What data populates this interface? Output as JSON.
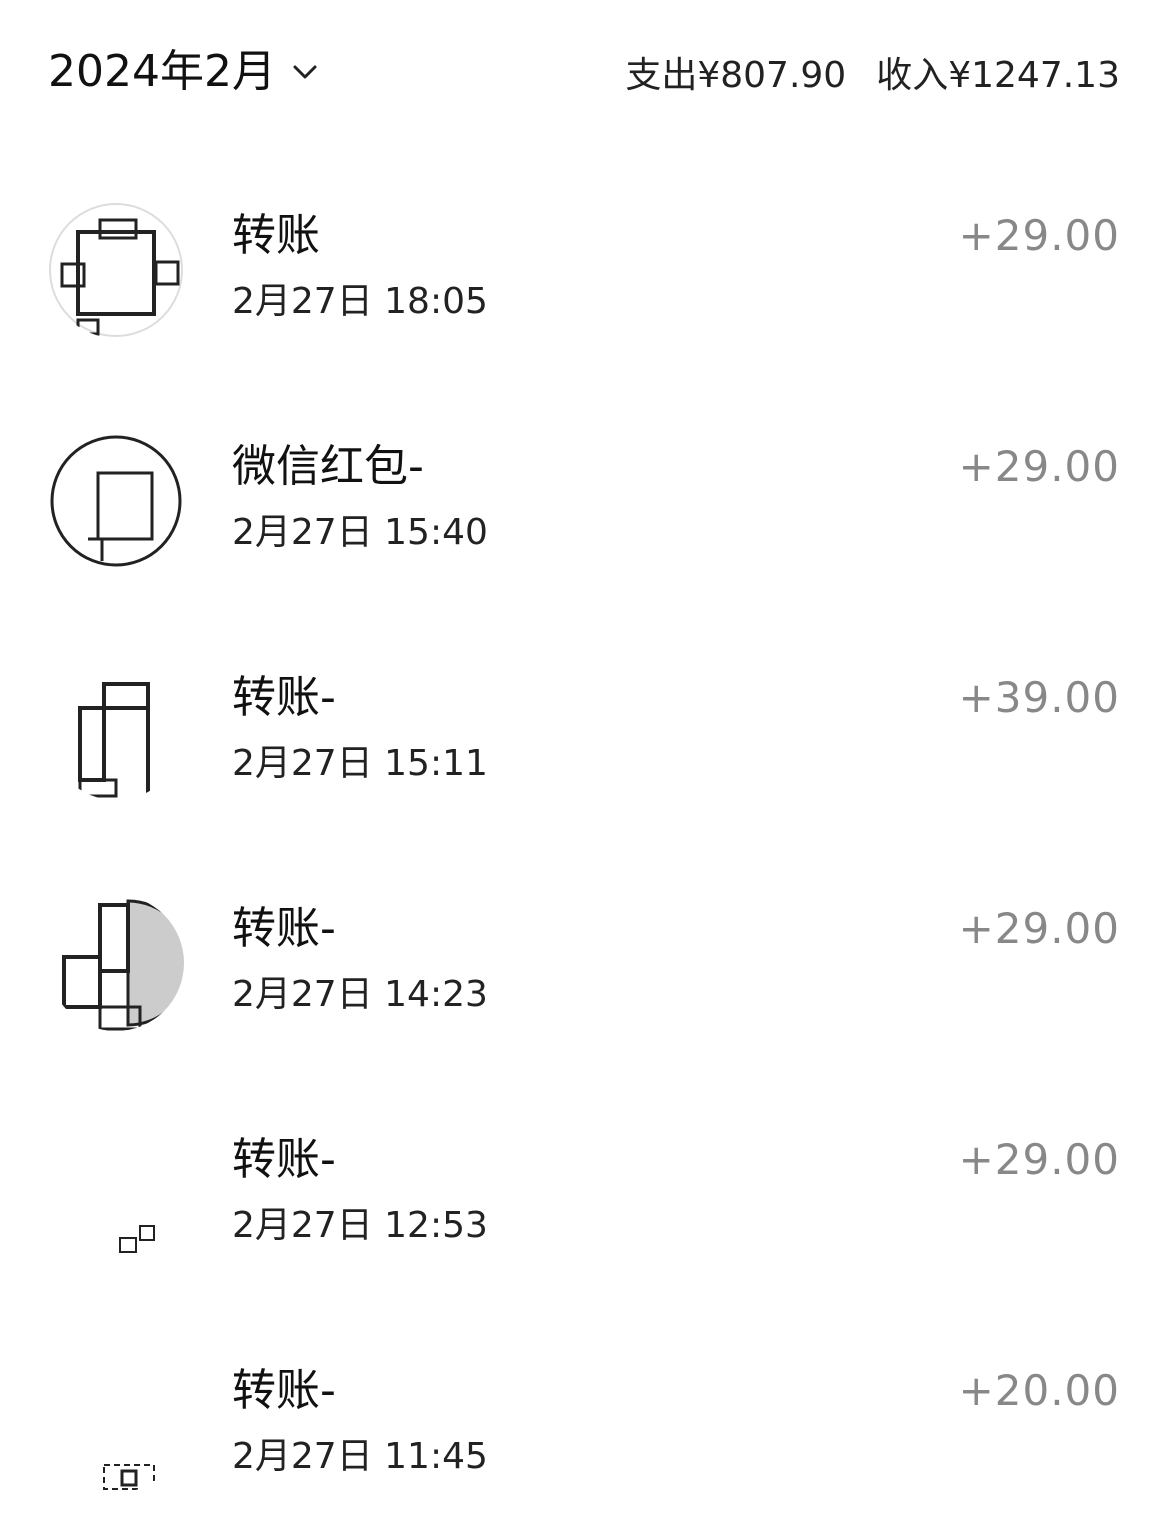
{
  "header": {
    "month": "2024年2月",
    "expense_label": "支出¥807.90",
    "income_label": "收入¥1247.13"
  },
  "transactions": [
    {
      "title": "转账",
      "time": "2月27日 18:05",
      "amount": "+29.00"
    },
    {
      "title": "微信红包-",
      "time": "2月27日 15:40",
      "amount": "+29.00"
    },
    {
      "title": "转账-",
      "time": "2月27日 15:11",
      "amount": "+39.00"
    },
    {
      "title": "转账-",
      "time": "2月27日 14:23",
      "amount": "+29.00"
    },
    {
      "title": "转账-",
      "time": "2月27日 12:53",
      "amount": "+29.00"
    },
    {
      "title": "转账-",
      "time": "2月27日 11:45",
      "amount": "+20.00"
    }
  ],
  "icons": {
    "month_picker": "chevron-down-icon"
  }
}
